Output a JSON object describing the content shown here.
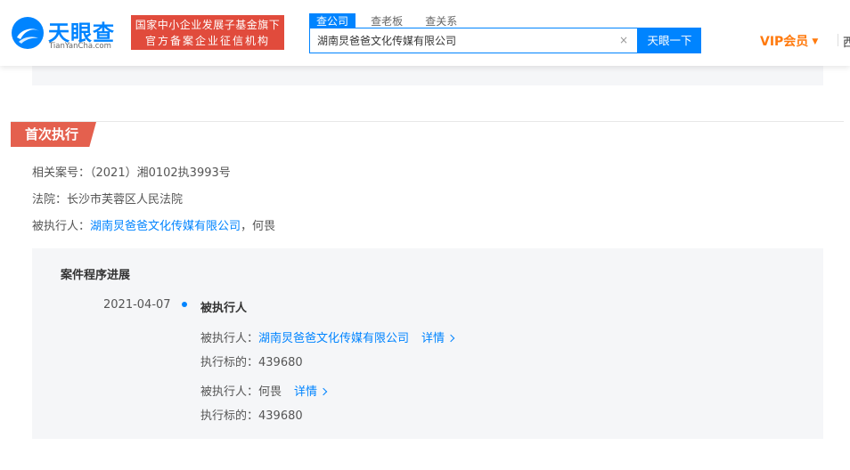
{
  "header": {
    "logo_title": "天眼查",
    "logo_sub": "TianYanCha.com",
    "badge_line1": "国家中小企业发展子基金旗下",
    "badge_line2": "官方备案企业征信机构",
    "tabs": [
      {
        "label": "查公司"
      },
      {
        "label": "查老板"
      },
      {
        "label": "查关系"
      }
    ],
    "search_value": "湖南炅爸爸文化传媒有限公司",
    "clear_glyph": "×",
    "search_button": "天眼一下",
    "vip_label": "VIP会员",
    "edge_text": "西",
    "colors": {
      "brand": "#0084ff",
      "badge": "#e14b3c",
      "vip": "#ff7a0e",
      "section_tag": "#e4604e"
    }
  },
  "section": {
    "title": "首次执行",
    "case_label": "相关案号：",
    "case_value": "（2021）湘0102执3993号",
    "court_label": "法院：",
    "court_value": "长沙市芙蓉区人民法院",
    "executed_label": "被执行人：",
    "executed_company": "湖南炅爸爸文化传媒有限公司",
    "executed_sep": "，",
    "executed_person": "何畏"
  },
  "progress": {
    "title": "案件程序进展",
    "date": "2021-04-07",
    "event_title": "被执行人",
    "entries": [
      {
        "label": "被执行人：",
        "name": "湖南炅爸爸文化传媒有限公司",
        "detail": "详情",
        "amount_label": "执行标的：",
        "amount": "439680"
      },
      {
        "label": "被执行人：",
        "name": "何畏",
        "detail": "详情",
        "amount_label": "执行标的：",
        "amount": "439680"
      }
    ]
  }
}
